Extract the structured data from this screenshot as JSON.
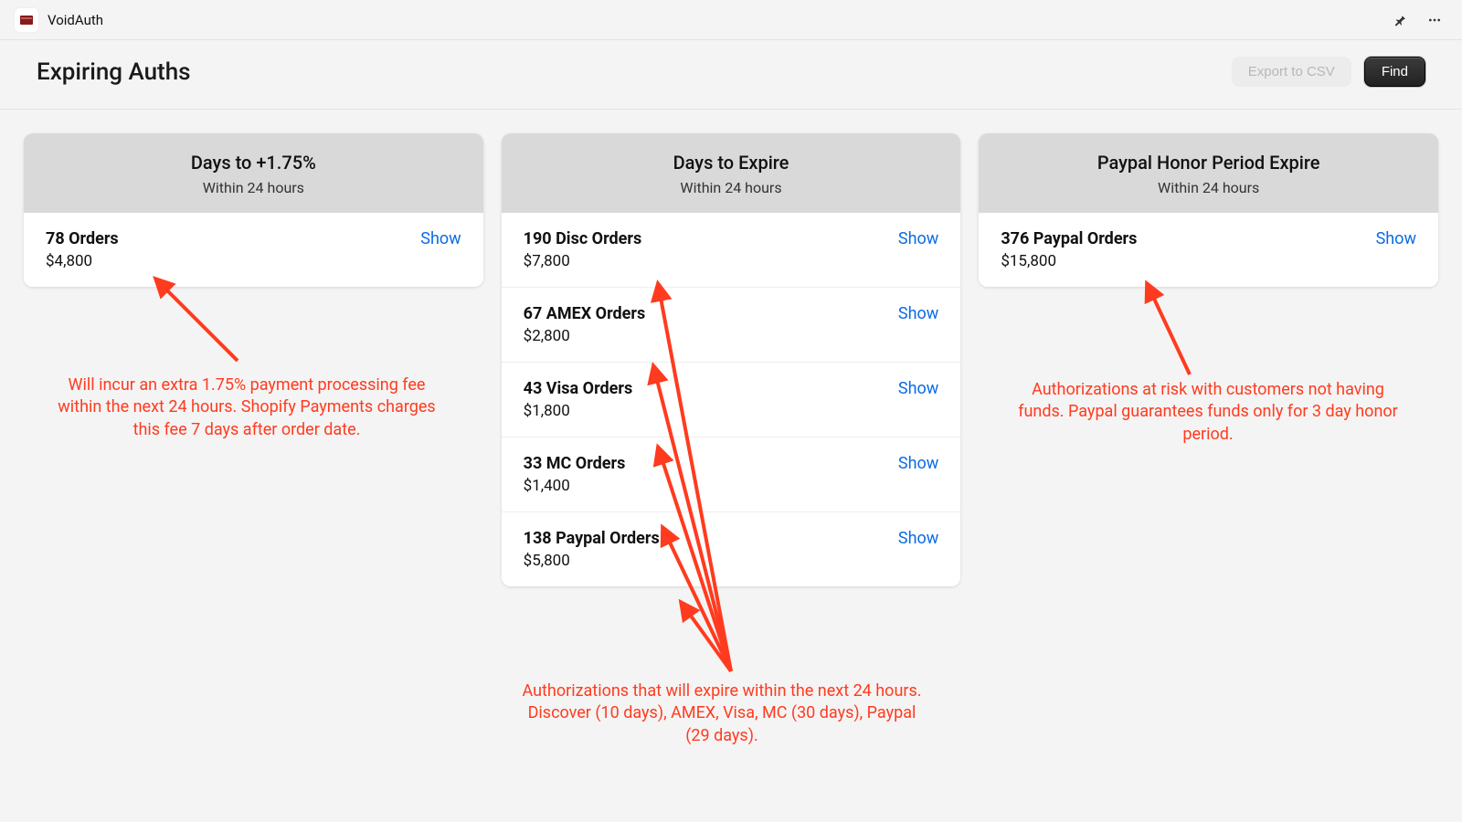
{
  "app": {
    "name": "VoidAuth"
  },
  "page": {
    "title": "Expiring Auths"
  },
  "actions": {
    "export_label": "Export to CSV",
    "find_label": "Find"
  },
  "cards": [
    {
      "title": "Days to +1.75%",
      "subtitle": "Within 24 hours",
      "rows": [
        {
          "title": "78 Orders",
          "amount": "$4,800",
          "link": "Show"
        }
      ]
    },
    {
      "title": "Days to Expire",
      "subtitle": "Within 24 hours",
      "rows": [
        {
          "title": "190 Disc Orders",
          "amount": "$7,800",
          "link": "Show"
        },
        {
          "title": "67 AMEX Orders",
          "amount": "$2,800",
          "link": "Show"
        },
        {
          "title": "43 Visa Orders",
          "amount": "$1,800",
          "link": "Show"
        },
        {
          "title": "33 MC Orders",
          "amount": "$1,400",
          "link": "Show"
        },
        {
          "title": "138 Paypal Orders",
          "amount": "$5,800",
          "link": "Show"
        }
      ]
    },
    {
      "title": "Paypal Honor Period Expire",
      "subtitle": "Within 24 hours",
      "rows": [
        {
          "title": "376 Paypal Orders",
          "amount": "$15,800",
          "link": "Show"
        }
      ]
    }
  ],
  "annotations": {
    "left": "Will incur an extra 1.75% payment processing fee within the next 24 hours.  Shopify Payments charges this fee 7 days after order date.",
    "middle": "Authorizations that will expire within the next 24 hours.  Discover (10 days), AMEX, Visa, MC (30 days), Paypal (29 days).",
    "right": "Authorizations at risk with customers not having funds.  Paypal guarantees funds only for 3 day honor period."
  }
}
